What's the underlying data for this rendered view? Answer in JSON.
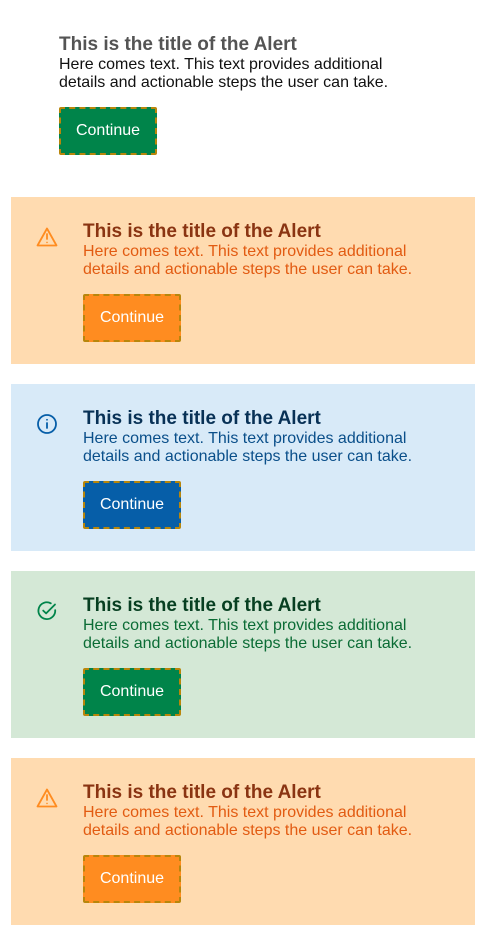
{
  "alerts": [
    {
      "variant": "plain",
      "icon": "none",
      "title": "This is the title of the Alert",
      "text": "Here comes text. This text provides additional details and actionable steps the user can take.",
      "button_label": "Continue",
      "colors": {
        "title": "#545454",
        "text": "#111111",
        "button": "#00844a"
      }
    },
    {
      "variant": "warning",
      "icon": "warning-icon",
      "title": "This is the title of the Alert",
      "text": "Here comes text. This text provides additional details and actionable steps the user can take.",
      "button_label": "Continue",
      "colors": {
        "background": "#ffdbb0",
        "title": "#8a3412",
        "text": "#e25b12",
        "button": "#ff8c20"
      }
    },
    {
      "variant": "info",
      "icon": "info-icon",
      "title": "This is the title of the Alert",
      "text": "Here comes text. This text provides additional details and actionable steps the user can take.",
      "button_label": "Continue",
      "colors": {
        "background": "#d8eaf8",
        "title": "#083156",
        "text": "#0a4f8a",
        "button": "#065ea8"
      }
    },
    {
      "variant": "success",
      "icon": "check-circle-icon",
      "title": "This is the title of the Alert",
      "text": "Here comes text. This text provides additional details and actionable steps the user can take.",
      "button_label": "Continue",
      "colors": {
        "background": "#d4e8d6",
        "title": "#073f21",
        "text": "#0b6c35",
        "button": "#00844a"
      }
    },
    {
      "variant": "warning",
      "icon": "warning-icon",
      "title": "This is the title of the Alert",
      "text": "Here comes text. This text provides additional details and actionable steps the user can take.",
      "button_label": "Continue",
      "colors": {
        "background": "#ffdbb0",
        "title": "#8a3412",
        "text": "#e25b12",
        "button": "#ff8c20"
      }
    }
  ]
}
